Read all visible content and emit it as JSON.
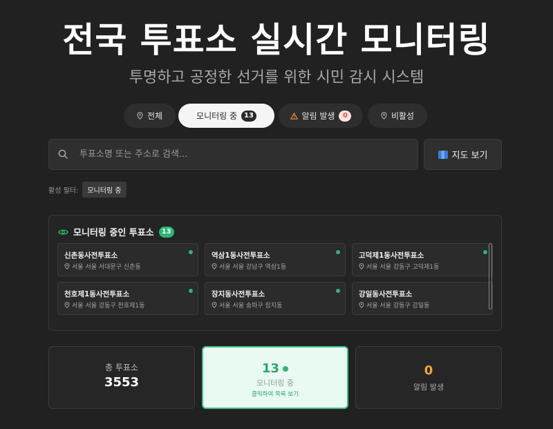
{
  "header": {
    "title": "전국 투표소 실시간 모니터링",
    "subtitle": "투명하고 공정한 선거를 위한 시민 감시 시스템"
  },
  "tabs": [
    {
      "label": "전체",
      "icon": "pin-icon",
      "badge": null,
      "active": false
    },
    {
      "label": "모니터링 중",
      "icon": null,
      "badge": "13",
      "active": true
    },
    {
      "label": "알림 발생",
      "icon": "warning-icon",
      "badge": "0",
      "active": false
    },
    {
      "label": "비활성",
      "icon": "pin-icon",
      "badge": null,
      "active": false
    }
  ],
  "search": {
    "placeholder": "투표소명 또는 주소로 검색...",
    "value": ""
  },
  "map_button": {
    "label": "지도 보기",
    "icon": "map-icon"
  },
  "active_filters": {
    "label": "활성 필터:",
    "chips": [
      "모니터링 중"
    ]
  },
  "panel": {
    "title": "모니터링 중인 투표소",
    "count": "13",
    "icon": "eye-icon",
    "stations": [
      {
        "name": "신촌동사전투표소",
        "address": "서울 서울 서대문구 신촌동"
      },
      {
        "name": "역삼1동사전투표소",
        "address": "서울 서울 강남구 역삼1동"
      },
      {
        "name": "고덕제1동사전투표소",
        "address": "서울 서울 강동구 고덕제1동"
      },
      {
        "name": "천호제1동사전투표소",
        "address": "서울 서울 강동구 천호제1동"
      },
      {
        "name": "장지동사전투표소",
        "address": "서울 서울 송파구 장지동"
      },
      {
        "name": "강일동사전투표소",
        "address": "서울 서울 강동구 강일동"
      }
    ]
  },
  "stats": {
    "total": {
      "label": "총 투표소",
      "value": "3553"
    },
    "monitoring": {
      "value": "13",
      "label": "모니터링 중",
      "hint": "클릭하여 목록 보기"
    },
    "alerts": {
      "value": "0",
      "label": "알림 발생"
    }
  },
  "colors": {
    "background": "#212121",
    "accent_green": "#2bb673",
    "alert_orange": "#f2a53a",
    "alert_badge": "#d9534f"
  }
}
